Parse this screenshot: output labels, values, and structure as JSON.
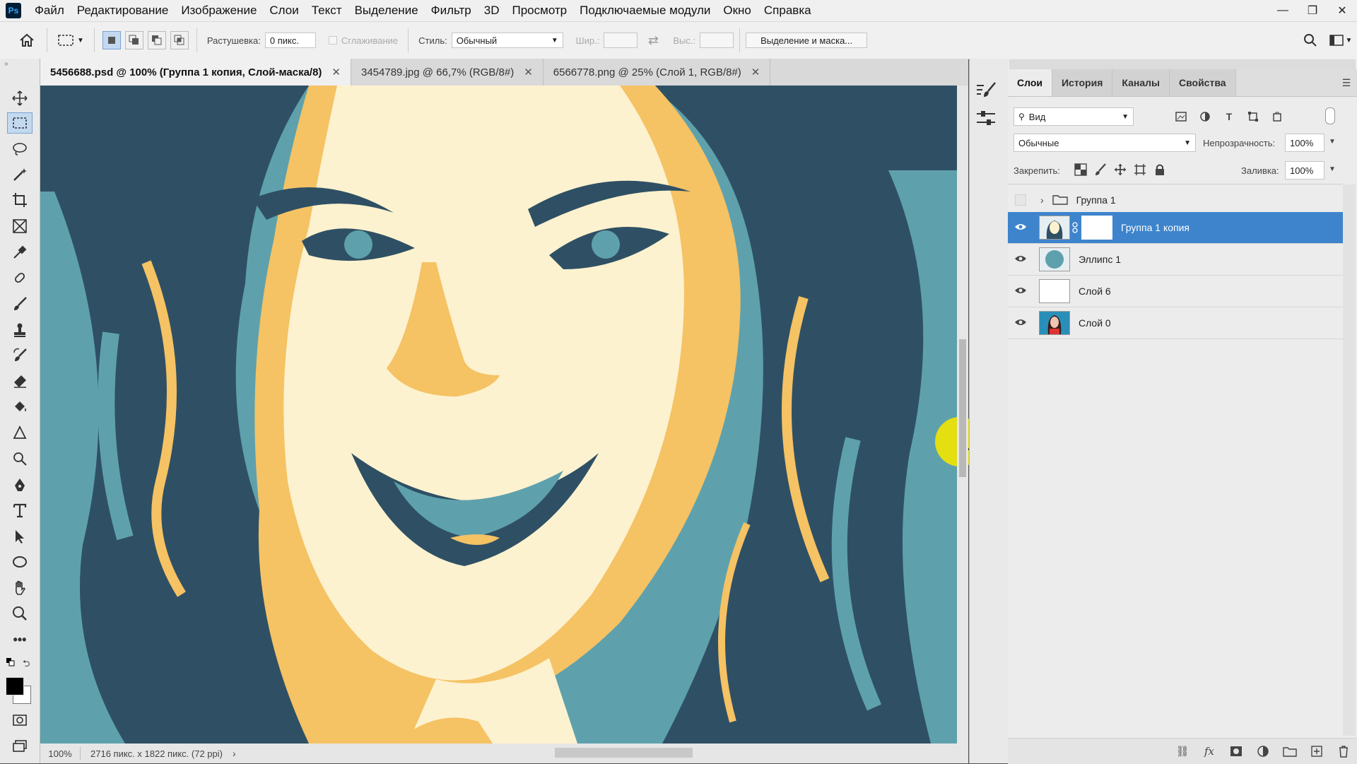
{
  "app": {
    "logo": "Ps"
  },
  "menu": [
    "Файл",
    "Редактирование",
    "Изображение",
    "Слои",
    "Текст",
    "Выделение",
    "Фильтр",
    "3D",
    "Просмотр",
    "Подключаемые модули",
    "Окно",
    "Справка"
  ],
  "window_controls": [
    "minimize-icon",
    "restore-icon",
    "close-icon"
  ],
  "options": {
    "feather_label": "Растушевка:",
    "feather_value": "0 пикс.",
    "antialias_label": "Сглаживание",
    "style_label": "Стиль:",
    "style_value": "Обычный",
    "width_label": "Шир.:",
    "height_label": "Выс.:",
    "mask_button": "Выделение и маска..."
  },
  "tabs": [
    {
      "label": "5456688.psd @ 100% (Группа 1 копия, Слой-маска/8)",
      "active": true
    },
    {
      "label": "3454789.jpg @ 66,7% (RGB/8#)",
      "active": false
    },
    {
      "label": "6566778.png @ 25% (Слой 1, RGB/8#)",
      "active": false
    }
  ],
  "status": {
    "zoom": "100%",
    "doc_info": "2716 пикс. x 1822 пикс. (72 ppi)"
  },
  "tools": [
    "move-icon",
    "marquee-icon",
    "lasso-icon",
    "magic-wand-icon",
    "crop-icon",
    "frame-icon",
    "eyedropper-icon",
    "healing-icon",
    "brush-icon",
    "stamp-icon",
    "history-brush-icon",
    "eraser-icon",
    "paint-bucket-icon",
    "blur-icon",
    "dodge-icon",
    "pen-icon",
    "type-icon",
    "path-select-icon",
    "ellipse-icon",
    "hand-icon",
    "zoom-icon",
    "more-icon"
  ],
  "panel": {
    "tabs": [
      {
        "label": "Слои",
        "active": true
      },
      {
        "label": "История",
        "active": false
      },
      {
        "label": "Каналы",
        "active": false
      },
      {
        "label": "Свойства",
        "active": false
      }
    ],
    "filter_value": "Вид",
    "blend_mode": "Обычные",
    "opacity_label": "Непрозрачность:",
    "opacity_value": "100%",
    "lock_label": "Закрепить:",
    "fill_label": "Заливка:",
    "fill_value": "100%",
    "layers": [
      {
        "name": "Группа 1",
        "type": "group",
        "visible": false,
        "selected": false
      },
      {
        "name": "Группа 1 копия",
        "type": "masked",
        "visible": true,
        "selected": true
      },
      {
        "name": "Эллипс 1",
        "type": "ellipse",
        "visible": true,
        "selected": false
      },
      {
        "name": "Слой 6",
        "type": "white",
        "visible": true,
        "selected": false
      },
      {
        "name": "Слой 0",
        "type": "photo",
        "visible": true,
        "selected": false
      }
    ]
  },
  "colors": {
    "accent": "#3d84cc",
    "art_dark": "#2f5064",
    "art_mid": "#5ea1ad",
    "art_orange": "#f5c264",
    "art_cream": "#fdf2cf",
    "cursor_highlight": "#f3e600"
  }
}
